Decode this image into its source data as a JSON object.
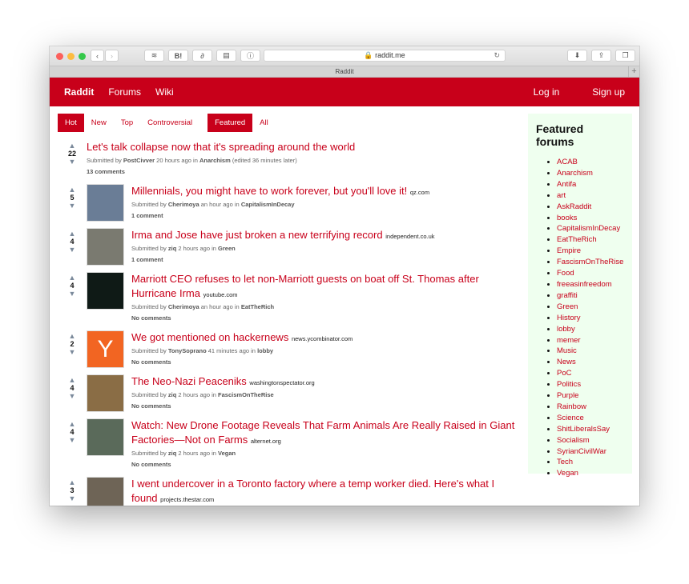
{
  "browser": {
    "url": "raddit.me",
    "tab_title": "Raddit",
    "toolbar_buttons": [
      "layers-icon",
      "B!",
      "link-icon",
      "notebook-icon",
      "info-icon"
    ],
    "right_buttons": [
      "download-icon",
      "share-icon",
      "tabs-icon"
    ]
  },
  "nav": {
    "brand": "Raddit",
    "links": [
      "Forums",
      "Wiki"
    ],
    "login": "Log in",
    "signup": "Sign up",
    "color": "#c8001a"
  },
  "sorts": {
    "left": [
      "Hot",
      "New",
      "Top",
      "Controversial"
    ],
    "right": [
      "Featured",
      "All"
    ],
    "active": [
      "Hot",
      "Featured"
    ]
  },
  "posts": [
    {
      "score": "22",
      "title": "Let's talk collapse now that it's spreading around the world",
      "domain": "",
      "user": "PostCivver",
      "time": "20 hours ago",
      "forum": "Anarchism",
      "edited": "(edited 36 minutes later)",
      "comments": "13 comments",
      "thumb": null
    },
    {
      "score": "5",
      "title": "Millennials, you might have to work forever, but you'll love it!",
      "domain": "qz.com",
      "user": "Cherimoya",
      "time": "an hour ago",
      "forum": "CapitalismInDecay",
      "comments": "1 comment",
      "thumb": "#6a7d96"
    },
    {
      "score": "4",
      "title": "Irma and Jose have just broken a new terrifying record",
      "domain": "independent.co.uk",
      "user": "ziq",
      "time": "2 hours ago",
      "forum": "Green",
      "comments": "1 comment",
      "thumb": "#7a7a70"
    },
    {
      "score": "4",
      "title": "Marriott CEO refuses to let non-Marriott guests on boat off St. Thomas after Hurricane Irma",
      "domain": "youtube.com",
      "user": "Cherimoya",
      "time": "an hour ago",
      "forum": "EatTheRich",
      "comments": "No comments",
      "thumb": "#0f1a16"
    },
    {
      "score": "2",
      "title": "We got mentioned on hackernews",
      "domain": "news.ycombinator.com",
      "user": "TonySoprano",
      "time": "41 minutes ago",
      "forum": "lobby",
      "comments": "No comments",
      "thumb": "#f26522",
      "thumb_text": "Y"
    },
    {
      "score": "4",
      "title": "The Neo-Nazi Peaceniks",
      "domain": "washingtonspectator.org",
      "user": "ziq",
      "time": "2 hours ago",
      "forum": "FascismOnTheRise",
      "comments": "No comments",
      "thumb": "#8a6d45"
    },
    {
      "score": "4",
      "title": "Watch: New Drone Footage Reveals That Farm Animals Are Really Raised in Giant Factories—Not on Farms",
      "domain": "alternet.org",
      "user": "ziq",
      "time": "2 hours ago",
      "forum": "Vegan",
      "comments": "No comments",
      "thumb": "#5a6a5a"
    },
    {
      "score": "3",
      "title": "I went undercover in a Toronto factory where a temp worker died. Here's what I found",
      "domain": "projects.thestar.com",
      "user": "",
      "time": "",
      "forum": "",
      "comments": "",
      "thumb": "#6e6456"
    }
  ],
  "labels": {
    "submitted_by": "Submitted by",
    "in": "in"
  },
  "sidebar": {
    "title": "Featured forums",
    "forums": [
      "ACAB",
      "Anarchism",
      "Antifa",
      "art",
      "AskRaddit",
      "books",
      "CapitalismInDecay",
      "EatTheRich",
      "Empire",
      "FascismOnTheRise",
      "Food",
      "freeasinfreedom",
      "graffiti",
      "Green",
      "History",
      "lobby",
      "memer",
      "Music",
      "News",
      "PoC",
      "Politics",
      "Purple",
      "Rainbow",
      "Science",
      "ShitLiberalsSay",
      "Socialism",
      "SyrianCivilWar",
      "Tech",
      "Vegan"
    ],
    "background": "#efffef"
  }
}
